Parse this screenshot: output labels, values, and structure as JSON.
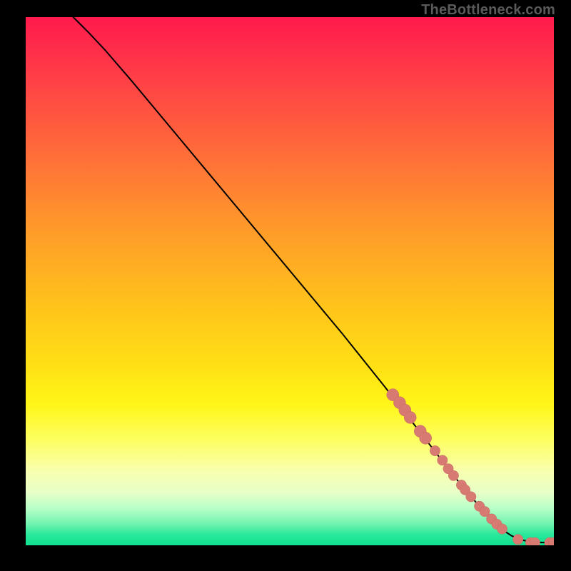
{
  "branding": {
    "text": "TheBottleneck.com"
  },
  "colors": {
    "line": "#000000",
    "marker_fill": "#d77a72",
    "marker_stroke": "#c96a62"
  },
  "chart_data": {
    "type": "line",
    "title": "",
    "xlabel": "",
    "ylabel": "",
    "xlim": [
      0,
      100
    ],
    "ylim": [
      0,
      100
    ],
    "x": [
      9.0,
      10.2,
      12.0,
      15.0,
      20.0,
      30.0,
      40.0,
      50.0,
      60.0,
      68.0,
      75.0,
      80.0,
      84.0,
      87.0,
      89.0,
      90.5,
      92.0,
      94.0,
      95.5,
      97.0,
      98.5,
      100.0
    ],
    "y": [
      100.0,
      98.8,
      97.0,
      93.8,
      88.0,
      76.0,
      64.0,
      52.0,
      40.0,
      30.0,
      21.0,
      14.5,
      9.5,
      6.3,
      4.0,
      2.8,
      1.8,
      1.0,
      0.7,
      0.55,
      0.5,
      0.5
    ],
    "markers": [
      {
        "x": 69.5,
        "y": 28.5,
        "size": "L"
      },
      {
        "x": 70.8,
        "y": 27.0,
        "size": "L"
      },
      {
        "x": 71.8,
        "y": 25.6,
        "size": "L"
      },
      {
        "x": 72.8,
        "y": 24.2,
        "size": "L"
      },
      {
        "x": 74.7,
        "y": 21.6,
        "size": "L"
      },
      {
        "x": 75.7,
        "y": 20.3,
        "size": "L"
      },
      {
        "x": 77.5,
        "y": 17.9,
        "size": "M"
      },
      {
        "x": 78.9,
        "y": 16.1,
        "size": "M"
      },
      {
        "x": 80.0,
        "y": 14.5,
        "size": "M"
      },
      {
        "x": 81.0,
        "y": 13.2,
        "size": "M"
      },
      {
        "x": 82.5,
        "y": 11.4,
        "size": "M"
      },
      {
        "x": 83.2,
        "y": 10.5,
        "size": "M"
      },
      {
        "x": 84.3,
        "y": 9.2,
        "size": "M"
      },
      {
        "x": 85.9,
        "y": 7.4,
        "size": "M"
      },
      {
        "x": 86.9,
        "y": 6.4,
        "size": "M"
      },
      {
        "x": 88.2,
        "y": 5.0,
        "size": "M"
      },
      {
        "x": 89.2,
        "y": 4.0,
        "size": "M"
      },
      {
        "x": 90.2,
        "y": 3.1,
        "size": "M"
      },
      {
        "x": 93.2,
        "y": 1.1,
        "size": "M"
      },
      {
        "x": 95.6,
        "y": 0.5,
        "size": "M"
      },
      {
        "x": 96.4,
        "y": 0.5,
        "size": "M"
      },
      {
        "x": 99.2,
        "y": 0.5,
        "size": "M"
      },
      {
        "x": 99.9,
        "y": 0.5,
        "size": "M"
      }
    ],
    "marker_radius_px": {
      "L": 8.5,
      "M": 7.2
    }
  }
}
